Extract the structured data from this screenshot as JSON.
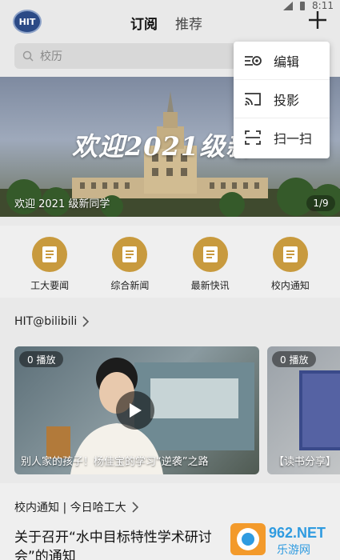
{
  "status": {
    "time": "8:11"
  },
  "header": {
    "logo_text": "HIT",
    "tabs": [
      {
        "label": "订阅",
        "active": true
      },
      {
        "label": "推荐",
        "active": false
      }
    ]
  },
  "search": {
    "placeholder": "校历"
  },
  "banner": {
    "headline": "欢迎2021级新",
    "caption": "欢迎 2021 级新同学",
    "counter": "1/9"
  },
  "quick_menu": [
    {
      "label": "工大要闻",
      "icon": "document-icon"
    },
    {
      "label": "综合新闻",
      "icon": "document-icon"
    },
    {
      "label": "最新快讯",
      "icon": "document-icon"
    },
    {
      "label": "校内通知",
      "icon": "document-icon"
    }
  ],
  "bilibili": {
    "title": "HIT@bilibili",
    "videos": [
      {
        "plays": "0 播放",
        "title": "别人家的孩子！杨佳宝的学习“逆袭”之路"
      },
      {
        "plays": "0 播放",
        "title": "【读书分享】"
      }
    ]
  },
  "notice": {
    "title": "校内通知 | 今日哈工大",
    "first_headline": "关于召开“水中目标特性学术研讨会”的通知"
  },
  "dropdown": [
    {
      "label": "编辑",
      "icon": "edit-icon"
    },
    {
      "label": "投影",
      "icon": "cast-icon"
    },
    {
      "label": "扫一扫",
      "icon": "scan-icon"
    }
  ],
  "watermark": {
    "text": "962.NET",
    "subtext": "乐游网"
  },
  "colors": {
    "accent_gold": "#c89a3e",
    "logo_blue": "#2b4a86"
  }
}
